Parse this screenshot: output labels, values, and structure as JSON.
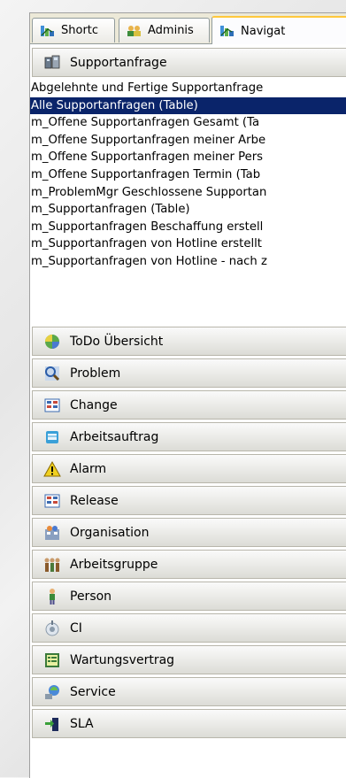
{
  "tabs": [
    {
      "label": "Shortc",
      "icon": "shortcut-icon",
      "active": false
    },
    {
      "label": "Adminis",
      "icon": "admin-icon",
      "active": false
    },
    {
      "label": "Navigat",
      "icon": "navigator-icon",
      "active": true
    }
  ],
  "open_group": {
    "label": "Supportanfrage",
    "icon": "support-request-icon"
  },
  "items": [
    {
      "label": "Abgelehnte und Fertige Supportanfrage",
      "selected": false
    },
    {
      "label": "Alle Supportanfragen (Table)",
      "selected": true
    },
    {
      "label": "m_Offene Supportanfragen Gesamt (Ta",
      "selected": false
    },
    {
      "label": "m_Offene Supportanfragen meiner Arbe",
      "selected": false
    },
    {
      "label": "m_Offene Supportanfragen meiner Pers",
      "selected": false
    },
    {
      "label": "m_Offene Supportanfragen Termin (Tab",
      "selected": false
    },
    {
      "label": "m_ProblemMgr Geschlossene Supportan",
      "selected": false
    },
    {
      "label": "m_Supportanfragen (Table)",
      "selected": false
    },
    {
      "label": "m_Supportanfragen Beschaffung erstell",
      "selected": false
    },
    {
      "label": "m_Supportanfragen von Hotline erstellt",
      "selected": false
    },
    {
      "label": "m_Supportanfragen von Hotline - nach z",
      "selected": false
    }
  ],
  "groups": [
    {
      "label": "ToDo Übersicht",
      "icon": "todo-icon"
    },
    {
      "label": "Problem",
      "icon": "problem-icon"
    },
    {
      "label": "Change",
      "icon": "change-icon"
    },
    {
      "label": "Arbeitsauftrag",
      "icon": "work-order-icon"
    },
    {
      "label": "Alarm",
      "icon": "alarm-warning-icon"
    },
    {
      "label": "Release",
      "icon": "release-icon"
    },
    {
      "label": "Organisation",
      "icon": "organisation-icon"
    },
    {
      "label": "Arbeitsgruppe",
      "icon": "workgroup-icon"
    },
    {
      "label": "Person",
      "icon": "person-icon"
    },
    {
      "label": "CI",
      "icon": "ci-icon"
    },
    {
      "label": "Wartungsvertrag",
      "icon": "maintenance-contract-icon"
    },
    {
      "label": "Service",
      "icon": "service-icon"
    },
    {
      "label": "SLA",
      "icon": "sla-icon"
    }
  ],
  "colors": {
    "selection": "#0a246a",
    "tab_active_accent": "#ffc83c",
    "frame": "#ece9d8"
  }
}
